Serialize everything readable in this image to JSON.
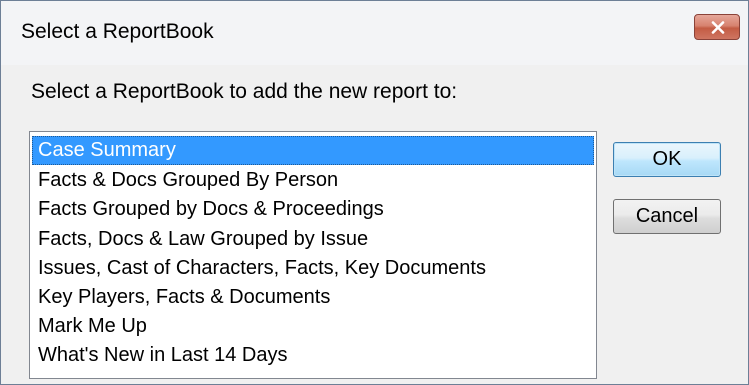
{
  "window": {
    "title": "Select a ReportBook",
    "close_icon": "close-icon",
    "close_color": "#c75b42"
  },
  "prompt": "Select a ReportBook to add the new report to:",
  "list": {
    "selected_index": 0,
    "selection_color": "#3399ff",
    "items": [
      {
        "label": "Case Summary"
      },
      {
        "label": "Facts & Docs Grouped By Person"
      },
      {
        "label": "Facts Grouped by Docs & Proceedings"
      },
      {
        "label": "Facts, Docs & Law Grouped by Issue"
      },
      {
        "label": "Issues, Cast of Characters, Facts, Key Documents"
      },
      {
        "label": "Key Players, Facts & Documents"
      },
      {
        "label": "Mark Me Up"
      },
      {
        "label": "What's New in Last 14 Days"
      }
    ]
  },
  "buttons": {
    "ok_label": "OK",
    "cancel_label": "Cancel"
  }
}
